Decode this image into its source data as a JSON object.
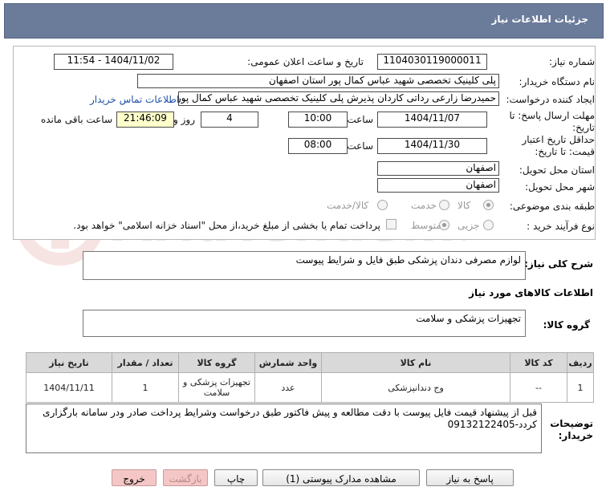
{
  "header": {
    "title": "جزئیات اطلاعات نیاز"
  },
  "form": {
    "need_number_label": "شماره نیاز:",
    "need_number": "1104030119000011",
    "announce_label": "تاریخ و ساعت اعلان عمومی:",
    "announce_value": "1404/11/02 - 11:54",
    "buyer_org_label": "نام دستگاه خریدار:",
    "buyer_org": "پلی کلینیک تخصصی شهید عباس کمال پور استان اصفهان",
    "creator_label": "ایجاد کننده درخواست:",
    "creator": "حمیدرضا زارعی رداتی کاردان پذیرش پلی کلینیک تخصصی شهید عباس کمال پور",
    "contact_link": "اطلاعات تماس خریدار",
    "deadline_label": "مهلت ارسال پاسخ: تا تاریخ:",
    "deadline_date": "1404/11/07",
    "time_label": "ساعت",
    "deadline_time": "10:00",
    "days_value": "4",
    "days_label": "روز و",
    "remaining_time": "21:46:09",
    "remaining_label": "ساعت باقی مانده",
    "validity_label": "حداقل تاریخ اعتبار قیمت: تا تاریخ:",
    "validity_date": "1404/11/30",
    "validity_time": "08:00",
    "province_label": "استان محل تحویل:",
    "province": "اصفهان",
    "city_label": "شهر محل تحویل:",
    "city": "اصفهان",
    "category_label": "طبقه بندی موضوعی:",
    "category_options": [
      "کالا",
      "خدمت",
      "کالا/خدمت"
    ],
    "process_label": "نوع فرآیند خرید :",
    "process_options": [
      "جزیی",
      "متوسط"
    ],
    "payment_note": "پرداخت تمام یا بخشی از مبلغ خرید،از محل \"اسناد خزانه اسلامی\" خواهد بود."
  },
  "summary": {
    "label": "شرح کلی نیاز:",
    "text": "لوازم مصرفی دندان پزشکی طبق فایل و شرایط پیوست"
  },
  "goods_info": {
    "title": "اطلاعات کالاهای مورد نیاز"
  },
  "goods_group": {
    "label": "گروه کالا:",
    "value": "تجهیزات پزشکی و سلامت"
  },
  "table": {
    "headers": [
      "ردیف",
      "کد کالا",
      "نام کالا",
      "واحد شمارش",
      "گروه کالا",
      "تعداد / مقدار",
      "تاریخ نیاز"
    ],
    "rows": [
      [
        "1",
        "--",
        "وج دندانپزشکی",
        "عدد",
        "تجهیزات پزشکی و سلامت",
        "1",
        "1404/11/11"
      ]
    ]
  },
  "buyer_notes": {
    "label": "توضیحات خریدار:",
    "text": "قبل از پیشنهاد قیمت فایل پیوست با دقت مطالعه و پیش فاکتور طبق درخواست وشرایط پرداخت  صادر ودر سامانه بارگزاری کردد-09132122405"
  },
  "buttons": {
    "reply": "پاسخ به نیاز",
    "attachments": "مشاهده مدارک پیوستی (1)",
    "print": "چاپ",
    "back": "بازگشت",
    "exit": "خروج"
  },
  "colors": {
    "header_bg": "#6b7b9a",
    "remaining_bg": "#ffffcc",
    "exit_btn": "#f4c6c6",
    "link": "#1f4fa8"
  }
}
